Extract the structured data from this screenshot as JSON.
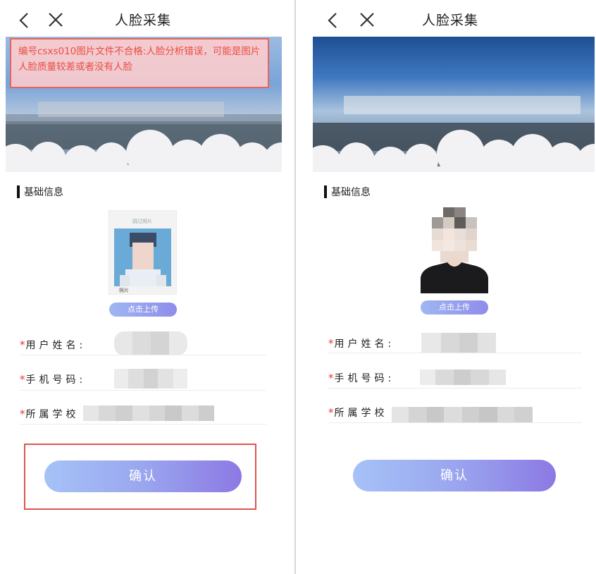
{
  "common": {
    "title": "人脸采集",
    "back_icon": "chevron-left-icon",
    "close_icon": "close-icon",
    "section_title": "基础信息",
    "upload_label": "点击上传",
    "confirm_label": "确认",
    "required_mark": "*",
    "fields": [
      {
        "label": "用户姓名:"
      },
      {
        "label": "手机号码:"
      },
      {
        "label": "所属学校"
      }
    ]
  },
  "left_screen": {
    "error_message": "编号csxs010图片文件不合格:人脸分析错误，可能是图片人脸质量较差或者没有人脸",
    "card_caption": "跳过照片",
    "card_name_tag": "照片"
  },
  "colors": {
    "error_bg": "#ffcdcd",
    "error_text": "#ec4d43",
    "error_border": "#e0665f",
    "required": "#e03c2f",
    "button_gradient_start": "#a6c2f7",
    "button_gradient_end": "#8c79e3"
  }
}
